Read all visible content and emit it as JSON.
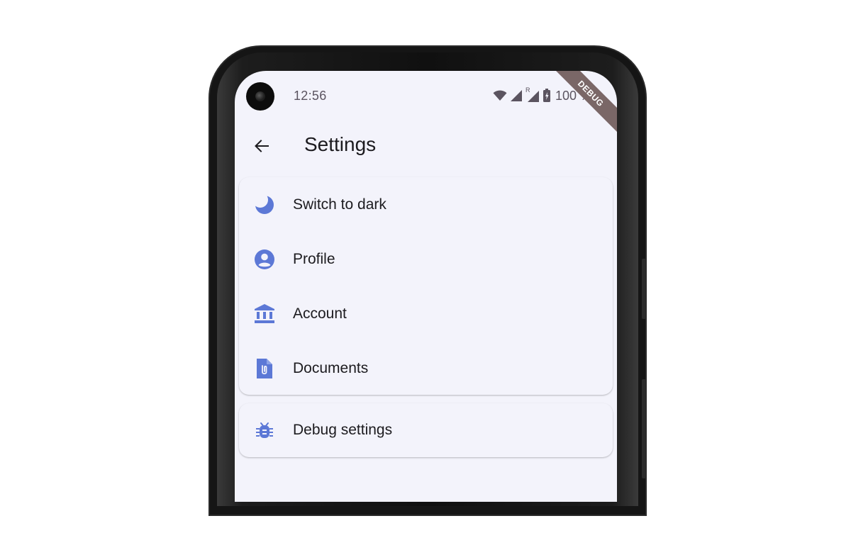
{
  "status_bar": {
    "time": "12:56",
    "battery_text": "100 %",
    "roaming_indicator": "R",
    "icons": [
      "wifi-icon",
      "signal-icon",
      "roaming-signal-icon",
      "battery-icon"
    ]
  },
  "debug_banner": "DEBUG",
  "app_bar": {
    "back_icon": "arrow-back-icon",
    "title": "Settings"
  },
  "settings_group": {
    "items": [
      {
        "label": "Switch to dark",
        "icon": "moon-icon"
      },
      {
        "label": "Profile",
        "icon": "account-circle-icon"
      },
      {
        "label": "Account",
        "icon": "bank-icon"
      },
      {
        "label": "Documents",
        "icon": "document-attachment-icon"
      }
    ]
  },
  "debug_group": {
    "items": [
      {
        "label": "Debug settings",
        "icon": "bug-icon"
      }
    ]
  },
  "colors": {
    "accent": "#5c78d6",
    "background": "#f3f3fb",
    "text": "#1c1b1f",
    "status": "#5b5460",
    "debug_ribbon": "#7a6767"
  }
}
